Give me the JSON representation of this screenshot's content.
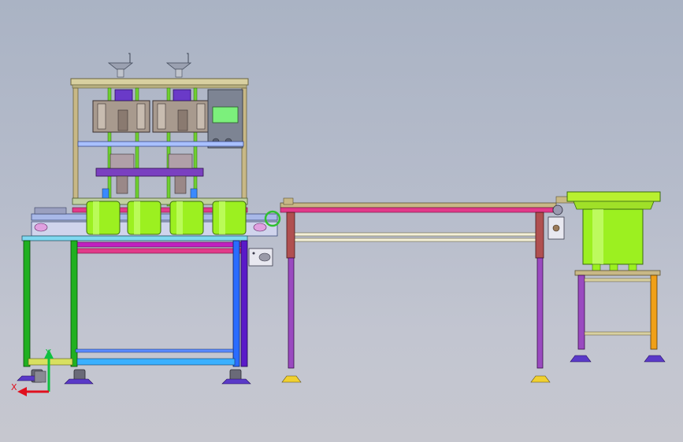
{
  "viewport": {
    "background_top": "#aab3c4",
    "background_bottom": "#c6c7cf"
  },
  "triad": {
    "x_label": "X",
    "y_label": "Y",
    "x_color": "#e0101e",
    "y_color": "#10c040"
  },
  "colors": {
    "frame_green": "#20b020",
    "frame_lime": "#8ce02a",
    "frame_blue": "#2a6cff",
    "frame_violet": "#5a1ac8",
    "frame_tan": "#c8b886",
    "rail_pink": "#e23a8a",
    "rail_magenta": "#c020c0",
    "hopper_lime": "#9cf020",
    "leg_purple": "#9a4ac0",
    "leg_orange": "#f0a018",
    "panel_grey": "#8a8f9e",
    "screen_green": "#7cf07c"
  },
  "components": [
    "filling-machine-frame",
    "filling-heads",
    "bottle-conveyor",
    "transfer-conveyor",
    "vibratory-bowl-feeder",
    "feeder-stand"
  ]
}
